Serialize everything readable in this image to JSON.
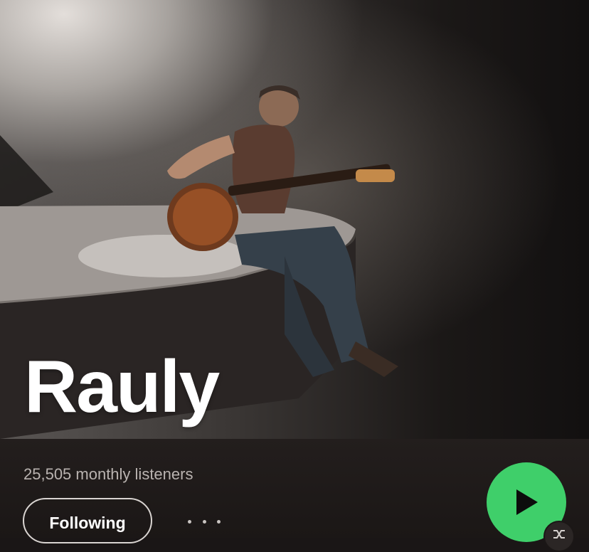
{
  "artist": {
    "name": "Rauly",
    "monthly_listeners": "25,505 monthly listeners"
  },
  "actions": {
    "follow_label": "Following",
    "more_icon": "more-horizontal-icon",
    "play_icon": "play-icon",
    "shuffle_icon": "shuffle-icon"
  },
  "colors": {
    "accent_green": "#3fcf6a",
    "background": "#1a1616",
    "secondary_text": "#b9b3b0"
  }
}
